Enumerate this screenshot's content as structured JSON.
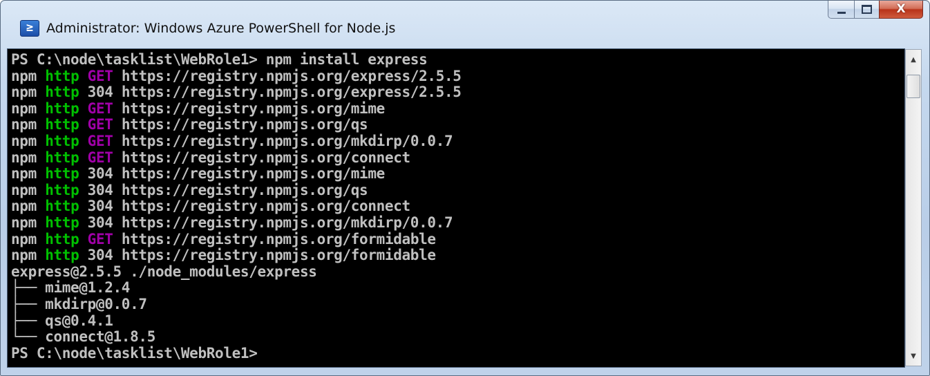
{
  "window": {
    "title": "Administrator: Windows Azure PowerShell for Node.js",
    "icon": "powershell-icon",
    "icon_glyph": "≥",
    "controls": {
      "minimize": "minimize-icon",
      "maximize": "maximize-icon",
      "close": "close-icon",
      "close_glyph": "X"
    }
  },
  "colors": {
    "console_bg": "#000000",
    "console_text": "#c0c0c0",
    "http": "#00c000",
    "get": "#a000a8"
  },
  "console": {
    "lines": [
      [
        {
          "t": "PS C:\\node\\tasklist\\WebRole1> npm install express",
          "c": "default"
        }
      ],
      [
        {
          "t": "npm ",
          "c": "default"
        },
        {
          "t": "http",
          "c": "green"
        },
        {
          "t": " ",
          "c": "default"
        },
        {
          "t": "GET",
          "c": "magenta"
        },
        {
          "t": " https://registry.npmjs.org/express/2.5.5",
          "c": "default"
        }
      ],
      [
        {
          "t": "npm ",
          "c": "default"
        },
        {
          "t": "http",
          "c": "green"
        },
        {
          "t": " 304 https://registry.npmjs.org/express/2.5.5",
          "c": "default"
        }
      ],
      [
        {
          "t": "npm ",
          "c": "default"
        },
        {
          "t": "http",
          "c": "green"
        },
        {
          "t": " ",
          "c": "default"
        },
        {
          "t": "GET",
          "c": "magenta"
        },
        {
          "t": " https://registry.npmjs.org/mime",
          "c": "default"
        }
      ],
      [
        {
          "t": "npm ",
          "c": "default"
        },
        {
          "t": "http",
          "c": "green"
        },
        {
          "t": " ",
          "c": "default"
        },
        {
          "t": "GET",
          "c": "magenta"
        },
        {
          "t": " https://registry.npmjs.org/qs",
          "c": "default"
        }
      ],
      [
        {
          "t": "npm ",
          "c": "default"
        },
        {
          "t": "http",
          "c": "green"
        },
        {
          "t": " ",
          "c": "default"
        },
        {
          "t": "GET",
          "c": "magenta"
        },
        {
          "t": " https://registry.npmjs.org/mkdirp/0.0.7",
          "c": "default"
        }
      ],
      [
        {
          "t": "npm ",
          "c": "default"
        },
        {
          "t": "http",
          "c": "green"
        },
        {
          "t": " ",
          "c": "default"
        },
        {
          "t": "GET",
          "c": "magenta"
        },
        {
          "t": " https://registry.npmjs.org/connect",
          "c": "default"
        }
      ],
      [
        {
          "t": "npm ",
          "c": "default"
        },
        {
          "t": "http",
          "c": "green"
        },
        {
          "t": " 304 https://registry.npmjs.org/mime",
          "c": "default"
        }
      ],
      [
        {
          "t": "npm ",
          "c": "default"
        },
        {
          "t": "http",
          "c": "green"
        },
        {
          "t": " 304 https://registry.npmjs.org/qs",
          "c": "default"
        }
      ],
      [
        {
          "t": "npm ",
          "c": "default"
        },
        {
          "t": "http",
          "c": "green"
        },
        {
          "t": " 304 https://registry.npmjs.org/connect",
          "c": "default"
        }
      ],
      [
        {
          "t": "npm ",
          "c": "default"
        },
        {
          "t": "http",
          "c": "green"
        },
        {
          "t": " 304 https://registry.npmjs.org/mkdirp/0.0.7",
          "c": "default"
        }
      ],
      [
        {
          "t": "npm ",
          "c": "default"
        },
        {
          "t": "http",
          "c": "green"
        },
        {
          "t": " ",
          "c": "default"
        },
        {
          "t": "GET",
          "c": "magenta"
        },
        {
          "t": " https://registry.npmjs.org/formidable",
          "c": "default"
        }
      ],
      [
        {
          "t": "npm ",
          "c": "default"
        },
        {
          "t": "http",
          "c": "green"
        },
        {
          "t": " 304 https://registry.npmjs.org/formidable",
          "c": "default"
        }
      ],
      [
        {
          "t": "express@2.5.5 ./node_modules/express",
          "c": "default"
        }
      ],
      [
        {
          "t": "├── mime@1.2.4",
          "c": "default"
        }
      ],
      [
        {
          "t": "├── mkdirp@0.0.7",
          "c": "default"
        }
      ],
      [
        {
          "t": "├── qs@0.4.1",
          "c": "default"
        }
      ],
      [
        {
          "t": "└── connect@1.8.5",
          "c": "default"
        }
      ],
      [
        {
          "t": "PS C:\\node\\tasklist\\WebRole1>",
          "c": "default"
        }
      ]
    ]
  },
  "scrollbar": {
    "up_icon": "scroll-up-arrow-icon",
    "up_glyph": "▲",
    "down_icon": "scroll-down-arrow-icon",
    "down_glyph": "▼"
  }
}
